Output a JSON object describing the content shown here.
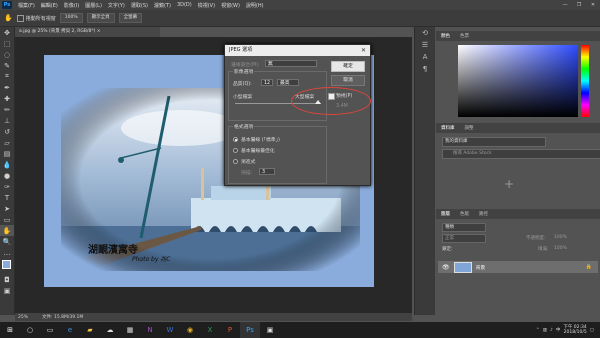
{
  "menubar": {
    "logo": "Ps",
    "items": [
      "檔案(F)",
      "編輯(E)",
      "影像(I)",
      "圖層(L)",
      "文字(Y)",
      "選取(S)",
      "濾鏡(T)",
      "3D(D)",
      "檢視(V)",
      "視窗(W)",
      "說明(H)"
    ],
    "window_controls": [
      "—",
      "❐",
      "✕"
    ]
  },
  "optbar": {
    "checkbox_label": "捲動所有視窗",
    "zoom_btn": "100%",
    "fit_btn": "顯示全頁",
    "fill_btn": "全螢幕"
  },
  "document": {
    "tab_title": "a.jpg @ 25% (背景 拷貝 2, RGB/8*) ×",
    "watermark": "湖靦濱寓寺",
    "watermark_credit": "Photo by 兆C"
  },
  "status": {
    "zoom": "25%",
    "doc_size": "文件: 15.8M/39.1M"
  },
  "dialog": {
    "title": "JPEG 選項",
    "matte_label": "邊緣調合(M):",
    "matte_value": "無",
    "image_options_label": "影像選項",
    "quality_label": "品質(Q):",
    "quality_value": "12",
    "quality_preset": "最高",
    "small_file": "小型檔案",
    "large_file": "大型檔案",
    "preview_label": "預視(P)",
    "file_size": "3.4M",
    "ok": "確定",
    "cancel": "取消",
    "format_label": "格式選項",
    "format_options": [
      "基本屬線 (「標準」)",
      "基本屬線最佳化",
      "漸進式"
    ],
    "scans_label": "掃描:",
    "scans_value": "3"
  },
  "panels": {
    "color_tabs": [
      "顏色",
      "色票"
    ],
    "library_tabs": [
      "資料庫",
      "調整"
    ],
    "library_dropdown": "我的資料庫",
    "library_search": "搜尋 Adobe Stock",
    "layers_tabs": [
      "圖層",
      "色版",
      "路徑"
    ],
    "layers_kind": "種類",
    "blend_mode": "正常",
    "opacity_label": "不透明度:",
    "opacity_value": "100%",
    "lock_label": "鎖定:",
    "fill_label": "填滿:",
    "fill_value": "100%",
    "layer_name": "背景"
  },
  "taskbar": {
    "time": "下午 02:34",
    "date": "2018/10/5",
    "lang": "中"
  }
}
